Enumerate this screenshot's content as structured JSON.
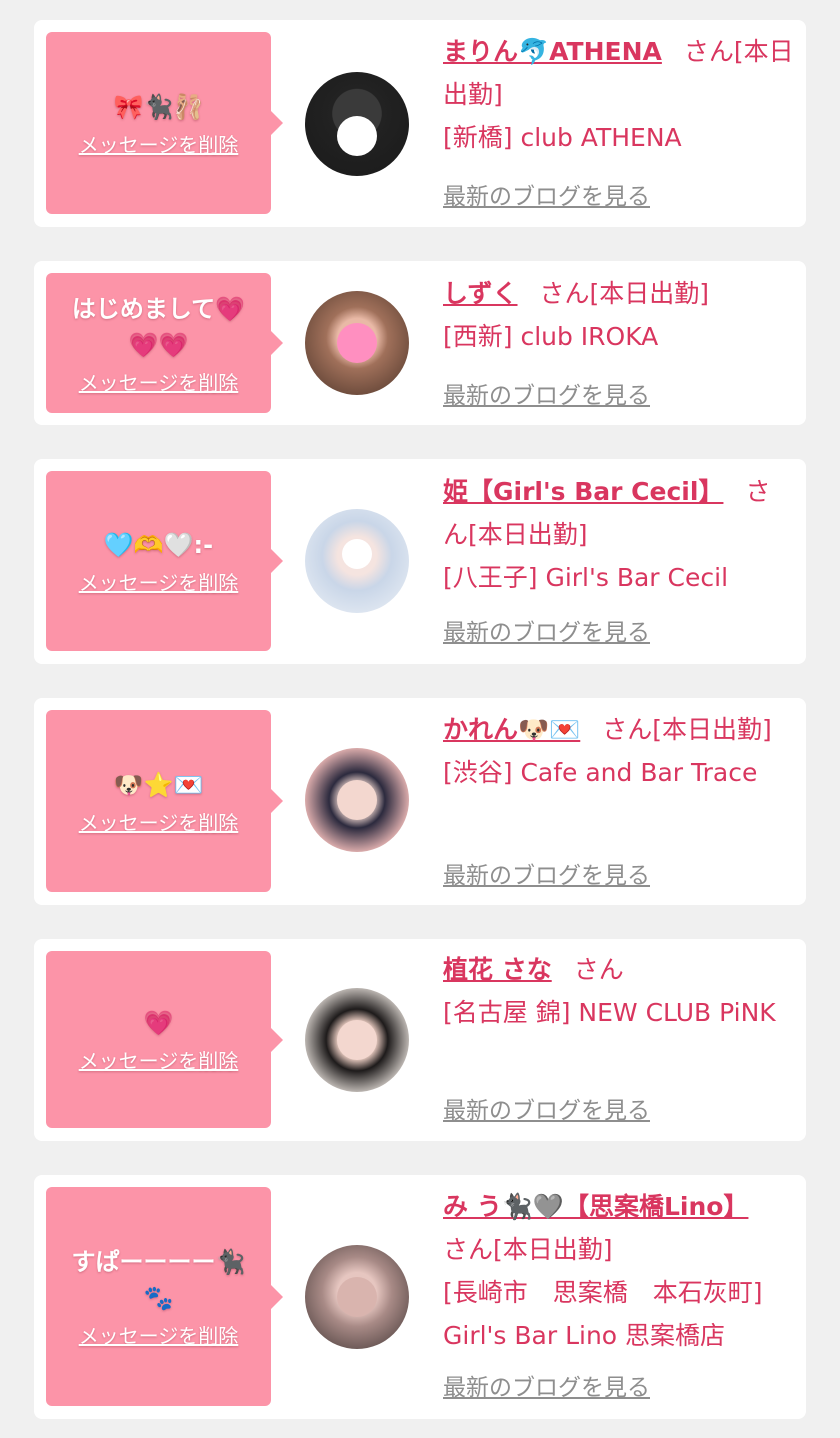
{
  "colors": {
    "accent": "#d9365f",
    "bubble": "#fc94a8",
    "background": "#f0f0f0"
  },
  "cards": [
    {
      "message": "🎀🐈‍⬛🩰",
      "delete_label": "メッセージを削除",
      "name": "まりん🐬ATHENA",
      "suffix": "さん[本日出勤]",
      "shop": "[新橋] club ATHENA",
      "blog_label": "最新のブログを見る"
    },
    {
      "message": "はじめまして💗💗💗",
      "delete_label": "メッセージを削除",
      "name": "しずく",
      "suffix": "さん[本日出勤]",
      "shop": "[西新] club IROKA",
      "blog_label": "最新のブログを見る"
    },
    {
      "message": "🩵🫶🤍:-",
      "delete_label": "メッセージを削除",
      "name": "姫【Girl's Bar Cecil】",
      "suffix": "さん[本日出勤]",
      "shop": "[八王子] Girl's Bar Cecil",
      "blog_label": "最新のブログを見る"
    },
    {
      "message": "🐶⭐💌",
      "delete_label": "メッセージを削除",
      "name": "かれん🐶💌",
      "suffix": "さん[本日出勤]",
      "shop": "[渋谷] Cafe and Bar Trace",
      "blog_label": "最新のブログを見る"
    },
    {
      "message": "💗",
      "delete_label": "メッセージを削除",
      "name": "植花 さな",
      "suffix": "さん",
      "shop": "[名古屋 錦] NEW CLUB PiNK",
      "blog_label": "最新のブログを見る"
    },
    {
      "message": "すぱーーーー🐈‍⬛🐾",
      "delete_label": "メッセージを削除",
      "name": "み う🐈‍⬛🩶【思案橋Lino】",
      "suffix": "さん[本日出勤]",
      "shop": "[長崎市　思案橋　本石灰町] Girl's Bar Lino 思案橋店",
      "blog_label": "最新のブログを見る"
    }
  ]
}
